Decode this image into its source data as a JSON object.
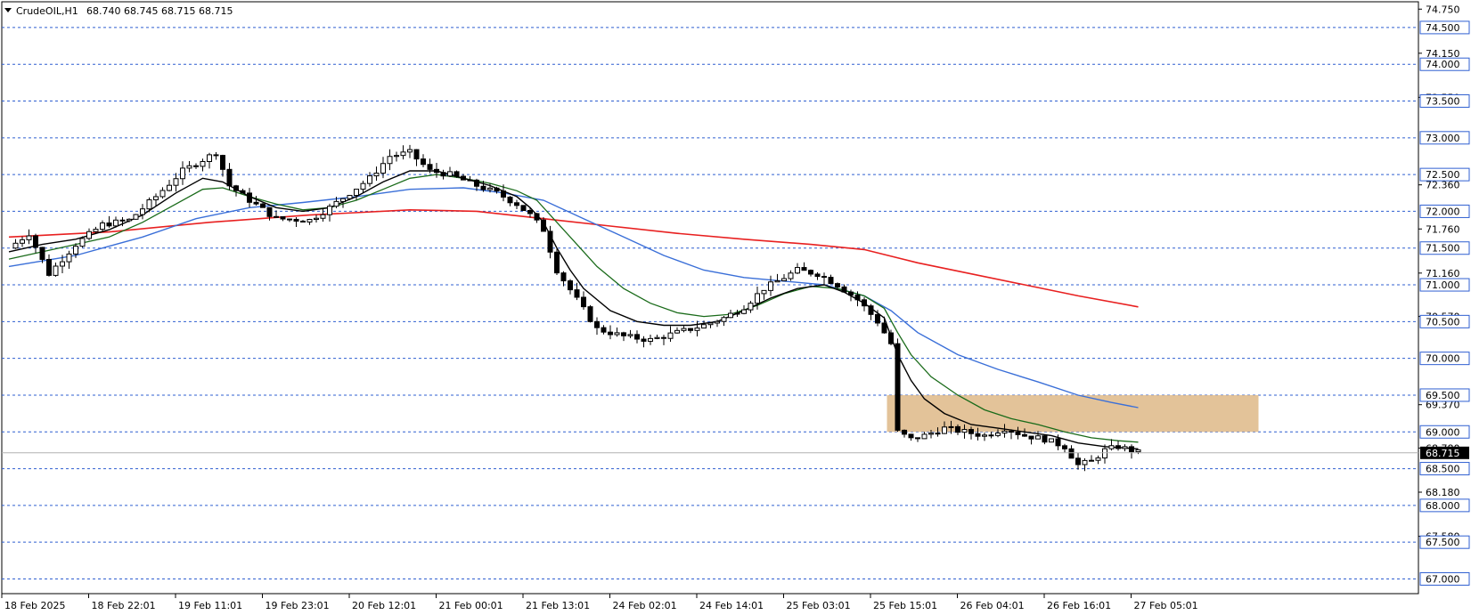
{
  "header": {
    "symbol": "CrudeOIL,H1",
    "ohlc": "68.740 68.745 68.715 68.715"
  },
  "colors": {
    "background": "#ffffff",
    "grid_line": "#2f5fd0",
    "candle_border": "#000000",
    "bull_fill": "#ffffff",
    "bear_fill": "#000000",
    "ma_fast": "#000000",
    "ma_medium": "#1a6b1a",
    "ma_slow": "#3a6fd8",
    "ma_long": "#e82020",
    "zone": "#deb887",
    "price_tag_bg": "#000000",
    "price_tag_fg": "#ffffff"
  },
  "chart_data": {
    "type": "candlestick",
    "ylim": [
      66.8,
      74.85
    ],
    "price_axis_ticks": [
      "74.750",
      "74.150",
      "73.550",
      "72.360",
      "71.760",
      "71.160",
      "70.570",
      "69.370",
      "68.780",
      "68.180",
      "67.580"
    ],
    "horizontal_levels": [
      "74.500",
      "74.000",
      "73.500",
      "73.000",
      "72.500",
      "72.000",
      "71.500",
      "71.000",
      "70.500",
      "70.000",
      "69.500",
      "69.000",
      "68.500",
      "68.000",
      "67.500",
      "67.000"
    ],
    "current_price": "68.715",
    "time_labels": [
      "18 Feb 2025",
      "18 Feb 22:01",
      "19 Feb 11:01",
      "19 Feb 23:01",
      "20 Feb 12:01",
      "21 Feb 00:01",
      "21 Feb 13:01",
      "24 Feb 02:01",
      "24 Feb 14:01",
      "25 Feb 03:01",
      "25 Feb 15:01",
      "26 Feb 04:01",
      "26 Feb 16:01",
      "27 Feb 05:01"
    ],
    "zone": {
      "price_from": 69.0,
      "price_to": 69.5
    },
    "bars_per_label": 13,
    "close_path": [
      [
        0,
        71.5
      ],
      [
        3,
        71.7
      ],
      [
        6,
        71.15
      ],
      [
        10,
        71.55
      ],
      [
        14,
        71.82
      ],
      [
        18,
        71.88
      ],
      [
        22,
        72.2
      ],
      [
        26,
        72.55
      ],
      [
        29,
        72.7
      ],
      [
        31,
        72.8
      ],
      [
        33,
        72.35
      ],
      [
        36,
        72.15
      ],
      [
        40,
        71.9
      ],
      [
        45,
        71.88
      ],
      [
        48,
        72.05
      ],
      [
        51,
        72.25
      ],
      [
        54,
        72.45
      ],
      [
        57,
        72.75
      ],
      [
        60,
        72.8
      ],
      [
        63,
        72.55
      ],
      [
        66,
        72.5
      ],
      [
        70,
        72.35
      ],
      [
        73,
        72.25
      ],
      [
        76,
        72.1
      ],
      [
        78,
        71.95
      ],
      [
        80,
        71.75
      ],
      [
        82,
        71.2
      ],
      [
        85,
        70.8
      ],
      [
        88,
        70.4
      ],
      [
        92,
        70.3
      ],
      [
        96,
        70.25
      ],
      [
        100,
        70.35
      ],
      [
        104,
        70.45
      ],
      [
        107,
        70.55
      ],
      [
        110,
        70.7
      ],
      [
        113,
        70.95
      ],
      [
        116,
        71.1
      ],
      [
        118,
        71.2
      ],
      [
        121,
        71.15
      ],
      [
        124,
        71.0
      ],
      [
        127,
        70.8
      ],
      [
        130,
        70.5
      ],
      [
        132,
        70.2
      ],
      [
        133,
        69.0
      ],
      [
        135,
        68.9
      ],
      [
        137,
        68.95
      ],
      [
        140,
        69.05
      ],
      [
        143,
        69.0
      ],
      [
        146,
        68.95
      ],
      [
        149,
        69.05
      ],
      [
        152,
        68.95
      ],
      [
        155,
        68.9
      ],
      [
        158,
        68.8
      ],
      [
        160,
        68.55
      ],
      [
        162,
        68.6
      ],
      [
        164,
        68.75
      ],
      [
        166,
        68.8
      ],
      [
        168,
        68.75
      ],
      [
        169,
        68.72
      ]
    ],
    "series": [
      {
        "key": "ma_fast",
        "points": [
          [
            0,
            71.45
          ],
          [
            5,
            71.55
          ],
          [
            10,
            71.62
          ],
          [
            15,
            71.75
          ],
          [
            20,
            71.95
          ],
          [
            25,
            72.25
          ],
          [
            29,
            72.45
          ],
          [
            32,
            72.4
          ],
          [
            36,
            72.2
          ],
          [
            40,
            72.05
          ],
          [
            44,
            72.0
          ],
          [
            48,
            72.05
          ],
          [
            52,
            72.2
          ],
          [
            56,
            72.4
          ],
          [
            60,
            72.55
          ],
          [
            64,
            72.55
          ],
          [
            68,
            72.45
          ],
          [
            72,
            72.35
          ],
          [
            76,
            72.2
          ],
          [
            78,
            72.05
          ],
          [
            80,
            71.85
          ],
          [
            82,
            71.5
          ],
          [
            84,
            71.2
          ],
          [
            86,
            70.95
          ],
          [
            90,
            70.65
          ],
          [
            94,
            70.5
          ],
          [
            98,
            70.45
          ],
          [
            102,
            70.45
          ],
          [
            106,
            70.5
          ],
          [
            110,
            70.65
          ],
          [
            114,
            70.82
          ],
          [
            118,
            70.95
          ],
          [
            122,
            71.0
          ],
          [
            125,
            70.9
          ],
          [
            128,
            70.75
          ],
          [
            131,
            70.55
          ],
          [
            133,
            70.05
          ],
          [
            135,
            69.7
          ],
          [
            137,
            69.45
          ],
          [
            140,
            69.25
          ],
          [
            144,
            69.1
          ],
          [
            148,
            69.05
          ],
          [
            152,
            69.0
          ],
          [
            156,
            68.95
          ],
          [
            160,
            68.85
          ],
          [
            164,
            68.8
          ],
          [
            169,
            68.77
          ]
        ]
      },
      {
        "key": "ma_medium",
        "points": [
          [
            0,
            71.35
          ],
          [
            5,
            71.45
          ],
          [
            10,
            71.55
          ],
          [
            15,
            71.65
          ],
          [
            20,
            71.85
          ],
          [
            25,
            72.1
          ],
          [
            29,
            72.3
          ],
          [
            32,
            72.32
          ],
          [
            36,
            72.2
          ],
          [
            40,
            72.1
          ],
          [
            44,
            72.02
          ],
          [
            48,
            72.05
          ],
          [
            52,
            72.15
          ],
          [
            56,
            72.3
          ],
          [
            60,
            72.45
          ],
          [
            64,
            72.5
          ],
          [
            68,
            72.45
          ],
          [
            72,
            72.38
          ],
          [
            76,
            72.28
          ],
          [
            79,
            72.15
          ],
          [
            82,
            71.85
          ],
          [
            85,
            71.55
          ],
          [
            88,
            71.25
          ],
          [
            92,
            70.95
          ],
          [
            96,
            70.75
          ],
          [
            100,
            70.62
          ],
          [
            104,
            70.57
          ],
          [
            108,
            70.6
          ],
          [
            112,
            70.72
          ],
          [
            116,
            70.88
          ],
          [
            120,
            70.98
          ],
          [
            124,
            70.95
          ],
          [
            128,
            70.85
          ],
          [
            131,
            70.68
          ],
          [
            133,
            70.35
          ],
          [
            135,
            70.05
          ],
          [
            138,
            69.75
          ],
          [
            142,
            69.5
          ],
          [
            146,
            69.3
          ],
          [
            150,
            69.18
          ],
          [
            154,
            69.1
          ],
          [
            158,
            69.0
          ],
          [
            162,
            68.92
          ],
          [
            166,
            68.88
          ],
          [
            169,
            68.86
          ]
        ]
      },
      {
        "key": "ma_slow",
        "points": [
          [
            0,
            71.25
          ],
          [
            10,
            71.4
          ],
          [
            20,
            71.65
          ],
          [
            28,
            71.9
          ],
          [
            36,
            72.05
          ],
          [
            44,
            72.12
          ],
          [
            52,
            72.2
          ],
          [
            60,
            72.3
          ],
          [
            68,
            72.32
          ],
          [
            74,
            72.25
          ],
          [
            80,
            72.15
          ],
          [
            86,
            71.9
          ],
          [
            92,
            71.65
          ],
          [
            98,
            71.4
          ],
          [
            104,
            71.2
          ],
          [
            110,
            71.1
          ],
          [
            116,
            71.05
          ],
          [
            122,
            71.0
          ],
          [
            128,
            70.85
          ],
          [
            132,
            70.65
          ],
          [
            136,
            70.35
          ],
          [
            142,
            70.05
          ],
          [
            148,
            69.85
          ],
          [
            154,
            69.68
          ],
          [
            160,
            69.5
          ],
          [
            165,
            69.4
          ],
          [
            169,
            69.33
          ]
        ]
      },
      {
        "key": "ma_long",
        "points": [
          [
            0,
            71.65
          ],
          [
            15,
            71.72
          ],
          [
            30,
            71.85
          ],
          [
            45,
            71.95
          ],
          [
            60,
            72.02
          ],
          [
            70,
            72.0
          ],
          [
            80,
            71.9
          ],
          [
            90,
            71.8
          ],
          [
            100,
            71.7
          ],
          [
            110,
            71.62
          ],
          [
            120,
            71.55
          ],
          [
            128,
            71.48
          ],
          [
            136,
            71.3
          ],
          [
            144,
            71.15
          ],
          [
            152,
            71.0
          ],
          [
            160,
            70.85
          ],
          [
            169,
            70.7
          ]
        ]
      }
    ]
  }
}
